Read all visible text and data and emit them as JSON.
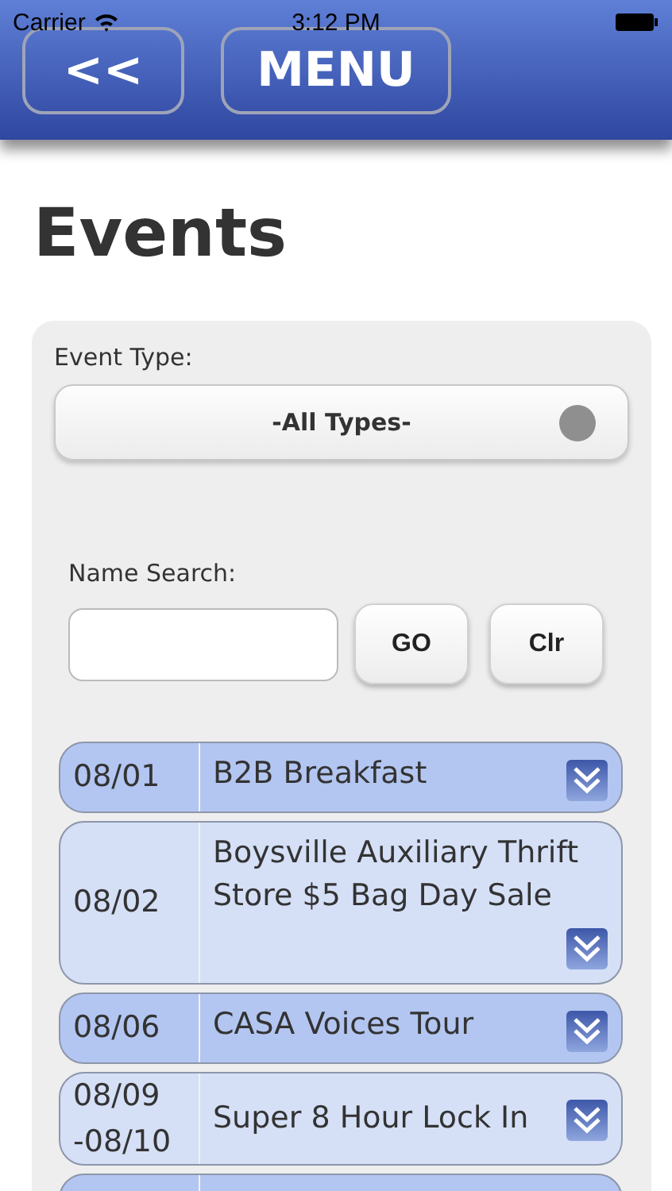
{
  "status_bar": {
    "carrier": "Carrier",
    "time": "3:12 PM"
  },
  "header": {
    "back_button": "<<",
    "menu_button": "MENU"
  },
  "title": "Events",
  "filters": {
    "event_type_label": "Event Type:",
    "event_type_value": "-All Types-",
    "name_search_label": "Name Search:",
    "go_button": "GO",
    "clear_button": "Clr"
  },
  "events": [
    {
      "date": "08/01",
      "title": "B2B Breakfast",
      "color": "#b3c6f1"
    },
    {
      "date": "08/02",
      "title": "Boysville Auxiliary Thrift Store $5 Bag Day Sale",
      "color": "#d5e0f7"
    },
    {
      "date": "08/06",
      "title": "CASA Voices Tour",
      "color": "#b3c6f1"
    },
    {
      "date": "08/09 -08/10",
      "title": "Super 8 Hour Lock In",
      "color": "#d5e0f7"
    },
    {
      "color": "#b3c6f1"
    }
  ]
}
